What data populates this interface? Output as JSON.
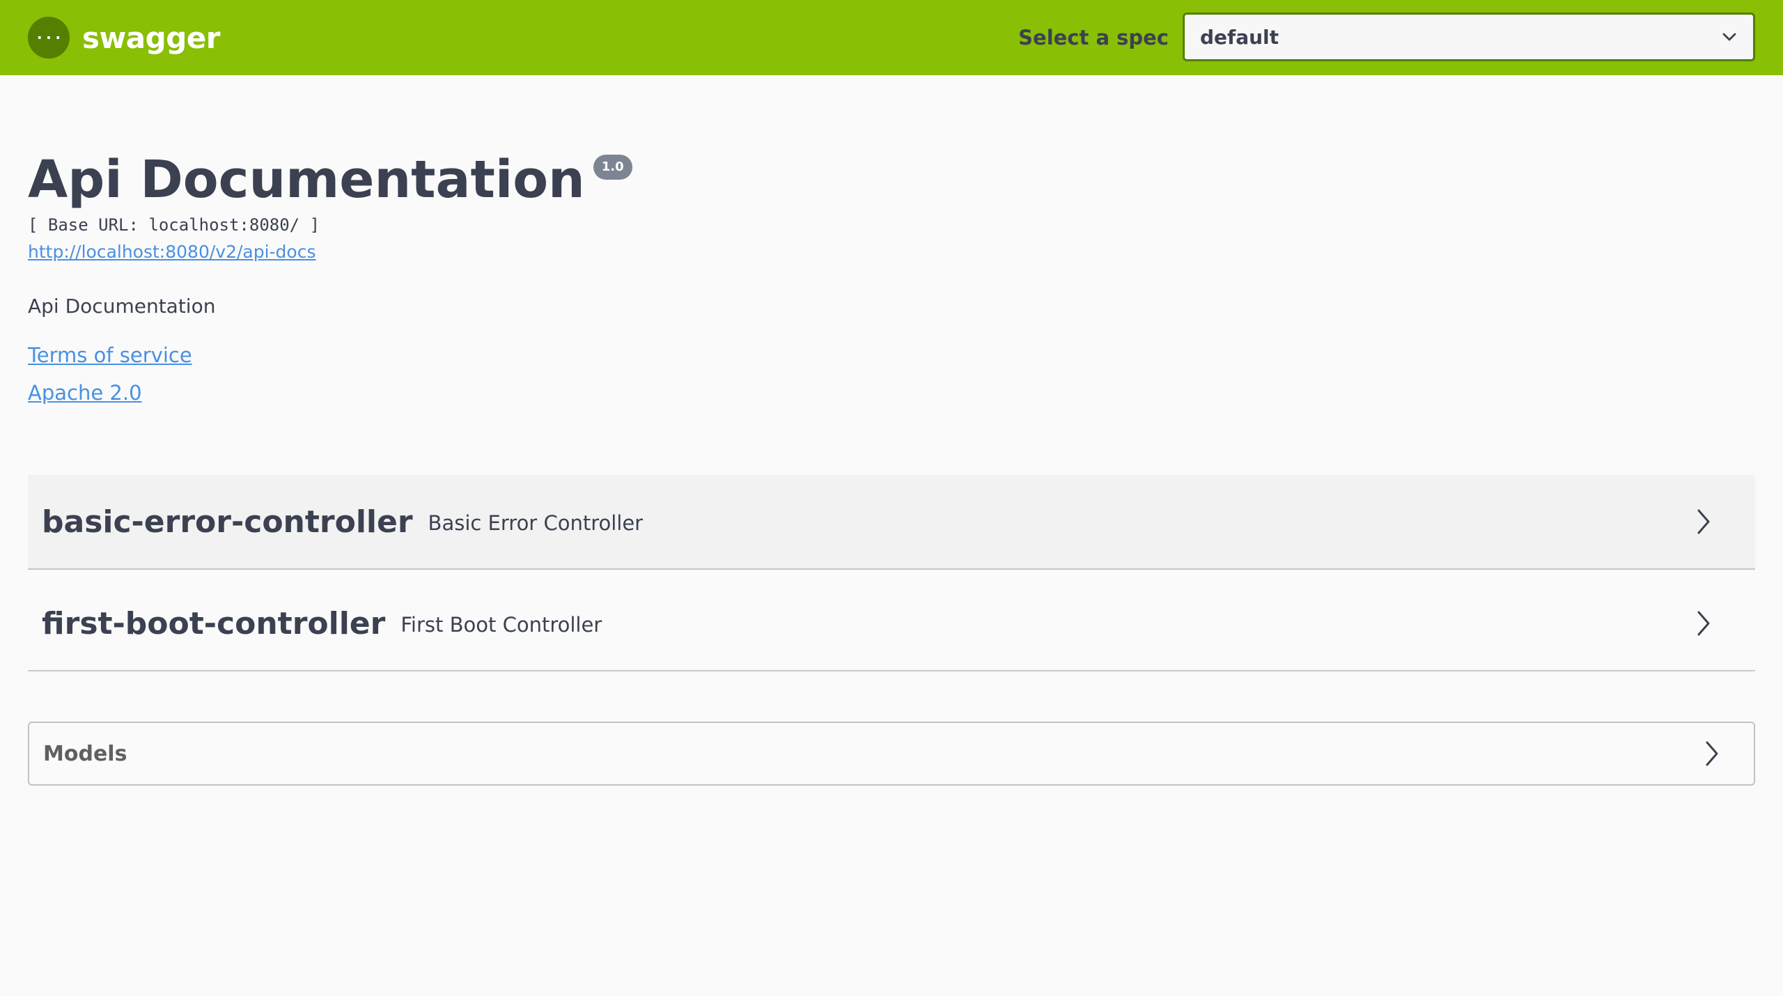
{
  "topbar": {
    "brand_name": "swagger",
    "logo_icon": "swagger-braces-icon",
    "spec_label": "Select a spec",
    "spec_selected": "default",
    "colors": {
      "bar": "#89bf04",
      "select_border": "#547f00"
    }
  },
  "info": {
    "title": "Api Documentation",
    "version": "1.0",
    "base_url": "[ Base URL: localhost:8080/ ]",
    "api_docs_url": "http://localhost:8080/v2/api-docs",
    "description": "Api Documentation",
    "terms_label": "Terms of service",
    "license_label": "Apache 2.0"
  },
  "tags": [
    {
      "name": "basic-error-controller",
      "description": "Basic Error Controller"
    },
    {
      "name": "first-boot-controller",
      "description": "First Boot Controller"
    }
  ],
  "models": {
    "label": "Models"
  },
  "link_color": "#4990e2"
}
